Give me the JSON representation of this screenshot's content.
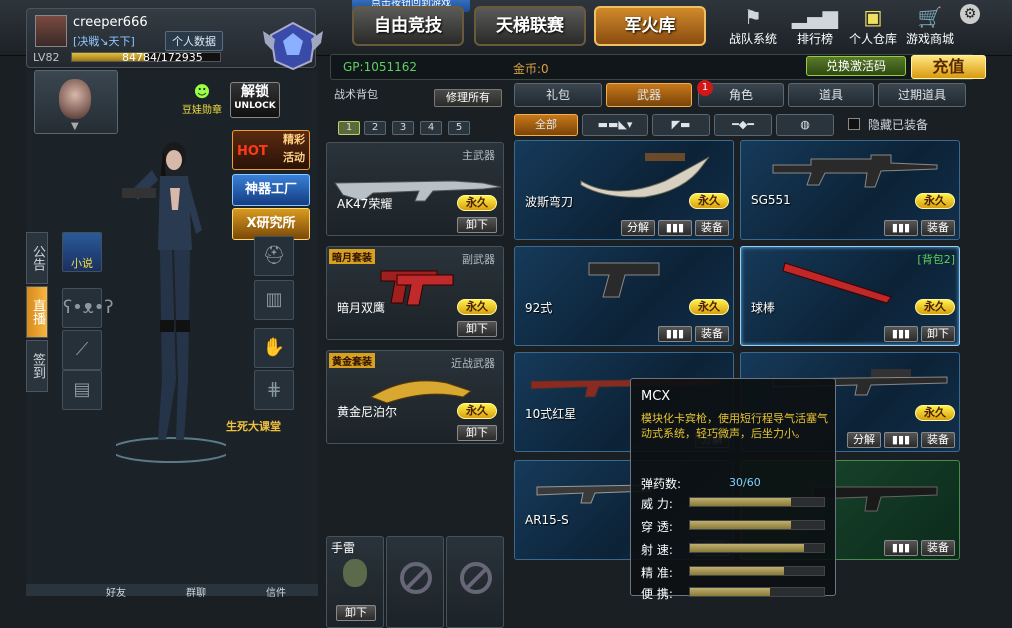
{
  "top_hint": "点击按钮回到游戏",
  "nav": {
    "free": "自由竞技",
    "ladder": "天梯联赛",
    "arsenal": "军火库"
  },
  "icons": {
    "team": "战队系统",
    "rank": "排行榜",
    "warehouse": "个人仓库",
    "mall": "游戏商城"
  },
  "profile": {
    "name": "creeper666",
    "clan": "[决戦↘天下]",
    "personal_data": "个人数据",
    "level": "LV82",
    "xp": "84784/172935",
    "xp_fraction": 0.49,
    "rank_label": "1级"
  },
  "currency": {
    "gp": "GP:1051162",
    "gold": "金币:0",
    "redeem": "兑换激活码",
    "charge": "充值"
  },
  "left": {
    "doudou": "豆娃勋章",
    "unlock": "解锁",
    "unlock_en": "UNLOCK",
    "hot": "HOT",
    "hot_text": "精彩活动",
    "artifact": "神器工厂",
    "xlab": "X研究所",
    "novel": "小说",
    "course": "生死大课堂",
    "sidetabs": [
      "公告",
      "直播",
      "签到"
    ],
    "bottom": [
      "好友",
      "群聊",
      "信件"
    ]
  },
  "backpack": {
    "title": "战术背包",
    "repair": "修理所有",
    "pages": [
      "1",
      "2",
      "3",
      "4",
      "5"
    ],
    "slots": [
      {
        "type": "主武器",
        "name": "AK47荣耀",
        "perm": "永久",
        "unequip": "卸下",
        "tag": ""
      },
      {
        "type": "副武器",
        "name": "暗月双鹰",
        "perm": "永久",
        "unequip": "卸下",
        "tag": "暗月套装"
      },
      {
        "type": "近战武器",
        "name": "黄金尼泊尔",
        "perm": "永久",
        "unequip": "卸下",
        "tag": "黄金套装"
      }
    ],
    "grenade": {
      "name": "手雷",
      "unequip": "卸下"
    }
  },
  "shop": {
    "tabs": [
      "礼包",
      "武器",
      "角色",
      "道具",
      "过期道具"
    ],
    "role_badge": "1",
    "filters": {
      "all": "全部"
    },
    "hide_equipped": "隐藏已装备",
    "cards": [
      {
        "name": "波斯弯刀",
        "perm": "永久",
        "btns": [
          "分解",
          "▮▮▮",
          "装备"
        ],
        "bag": ""
      },
      {
        "name": "SG551",
        "perm": "永久",
        "btns": [
          "▮▮▮",
          "装备"
        ],
        "bag": ""
      },
      {
        "name": "92式",
        "perm": "永久",
        "btns": [
          "▮▮▮",
          "装备"
        ],
        "bag": ""
      },
      {
        "name": "球棒",
        "perm": "永久",
        "btns": [
          "▮▮▮",
          "卸下"
        ],
        "bag": "[背包2]"
      },
      {
        "name": "10式红星",
        "perm": "",
        "btns": [
          "分解"
        ],
        "bag": ""
      },
      {
        "name": "",
        "perm": "永久",
        "btns": [
          "分解",
          "▮▮▮",
          "装备"
        ],
        "bag": ""
      },
      {
        "name": "AR15-S",
        "perm": "",
        "btns": [
          "分解"
        ],
        "bag": ""
      },
      {
        "name": "",
        "perm": "",
        "btns": [
          "▮▮▮",
          "装备"
        ],
        "bag": ""
      }
    ]
  },
  "tooltip": {
    "name": "MCX",
    "desc": "模块化卡宾枪，使用短行程导气活塞气动式系统，轻巧微声，后坐力小。",
    "ammo_label": "弹药数:",
    "ammo": "30/60",
    "stats": [
      {
        "label": "威  力:",
        "value": 0.75
      },
      {
        "label": "穿  透:",
        "value": 0.75
      },
      {
        "label": "射  速:",
        "value": 0.85
      },
      {
        "label": "精  准:",
        "value": 0.7
      },
      {
        "label": "便  携:",
        "value": 0.6
      }
    ]
  }
}
